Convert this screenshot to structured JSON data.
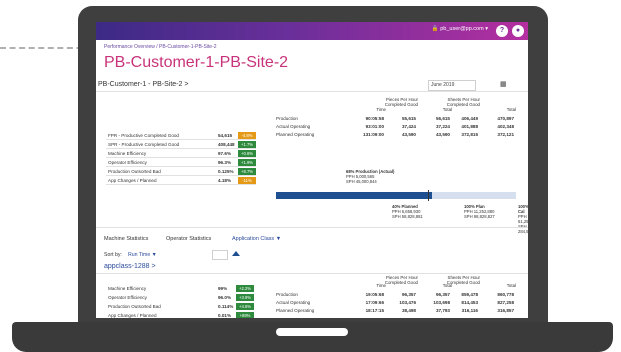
{
  "header": {
    "user": "pb_user@pp.com",
    "help_icon": "?",
    "menu_icon": "user-circle-icon"
  },
  "breadcrumb": "Performance Overview / PB-Customer-1-PB-Site-2",
  "page_title": "PB-Customer-1-PB-Site-2",
  "site_selector": "PB-Customer-1 - PB-Site-2 >",
  "date_value": "June 2019",
  "kpis": [
    {
      "label": "FPR - Productive Completed Good",
      "value": "54,615",
      "badge": "-4.8%",
      "badge_color": "#e59a17"
    },
    {
      "label": "SPR - Productive Completed Good",
      "value": "408,448",
      "badge": "+1.7%",
      "badge_color": "#2e8b3e"
    },
    {
      "label": "Machine Efficiency",
      "value": "97.6%",
      "badge": "+0.6%",
      "badge_color": "#2e8b3e"
    },
    {
      "label": "Operator Efficiency",
      "value": "96.3%",
      "badge": "+1.9%",
      "badge_color": "#2e8b3e"
    },
    {
      "label": "Production Outsorted Bad",
      "value": "0.125%",
      "badge": "+8.7%",
      "badge_color": "#2e8b3e"
    },
    {
      "label": "App Changes / Planned",
      "value": "4.18%",
      "badge": "-11%",
      "badge_color": "#e59a17"
    }
  ],
  "prod_table": {
    "headers": [
      "Time",
      "Pieces Per Hour Completed Good",
      "Total",
      "Sheets Per Hour Completed Good",
      "Total"
    ],
    "rows": [
      [
        "Production",
        "90:05:58",
        "55,615",
        "56,615",
        "406,449",
        "470,897"
      ],
      [
        "Actual Operating",
        "93:01:00",
        "37,424",
        "37,224",
        "401,888",
        "402,348"
      ],
      [
        "Planned Operating",
        "131:09:00",
        "43,590",
        "43,590",
        "372,815",
        "372,121"
      ]
    ]
  },
  "progress": {
    "fill_fraction": 0.65,
    "note_top": [
      "68% Production (Actual)",
      "PPH 5,000,565",
      "SPH 45,000,844"
    ],
    "cols": [
      [
        "40% Planned",
        "PPH 6,658,930",
        "SPH 58,828,881"
      ],
      [
        "100% Plan",
        "PPH 11,252,880",
        "SPH 98,828,827"
      ],
      [
        "100% Cal",
        "PPH 61,25",
        "SPH 284,52"
      ]
    ]
  },
  "tabs": [
    "Machine Statistics",
    "Operator Statistics",
    "Application Class"
  ],
  "sort_by_label": "Sort by:",
  "sort_by_value": "Run Time",
  "app_section": "appclass-1288 >",
  "app_kpis": [
    {
      "label": "Machine Efficiency",
      "value": "99%",
      "badge": "+2.2%"
    },
    {
      "label": "Operator Efficiency",
      "value": "96.0%",
      "badge": "+3.9%"
    },
    {
      "label": "Production Outsorted Bad",
      "value": "0.114%",
      "badge": "+4.6%"
    },
    {
      "label": "App Changes / Planned",
      "value": "0.01%",
      "badge": "+89%"
    }
  ],
  "app_table": {
    "headers": [
      "Time",
      "Pieces Per Hour Completed Good",
      "Total",
      "Sheets Per Hour Completed Good",
      "Total"
    ],
    "rows": [
      [
        "Production",
        "19:05:68",
        "96,357",
        "96,357",
        "859,478",
        "860,778"
      ],
      [
        "Actual Operating",
        "17:09:66",
        "103,476",
        "103,698",
        "814,453",
        "827,258"
      ],
      [
        "Planned Operating",
        "18:17:15",
        "38,498",
        "37,793",
        "316,116",
        "316,857"
      ]
    ]
  }
}
